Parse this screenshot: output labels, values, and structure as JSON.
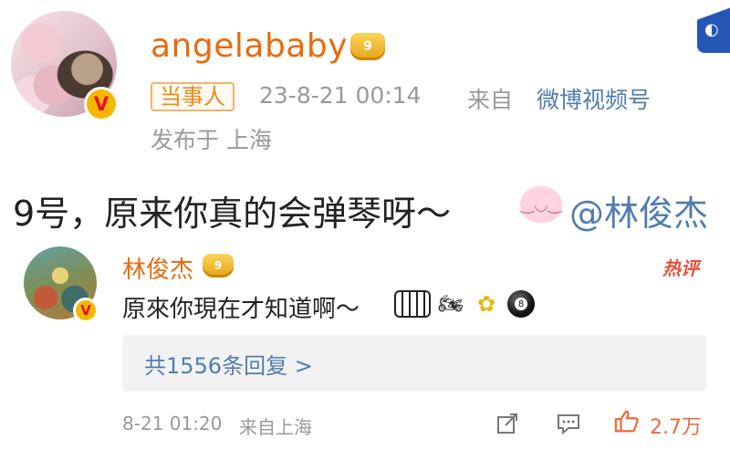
{
  "post": {
    "username": "angelababy",
    "party_tag": "当事人",
    "time": "23-8-21 00:14",
    "from_label": "来自",
    "source": "微博视频号",
    "location": "发布于 上海",
    "text": "9号，原来你真的会弹琴呀～",
    "mention": "@林俊杰",
    "verified_mark": "V",
    "crown_level": "9"
  },
  "comment": {
    "username": "林俊杰",
    "hot_label": "热评",
    "text": "原來你現在才知道啊～",
    "emojis": [
      "piano",
      "motorcycle",
      "bouquet",
      "8-ball"
    ],
    "ball_number": "8",
    "replies_link": "共1556条回复 >",
    "time": "8-21 01:20",
    "location": "来自上海",
    "likes": "2.7万",
    "verified_mark": "V",
    "crown_level": "9"
  },
  "colors": {
    "username": "#e86b0c",
    "link": "#507daf",
    "meta": "#999999",
    "like": "#f26a3c"
  }
}
